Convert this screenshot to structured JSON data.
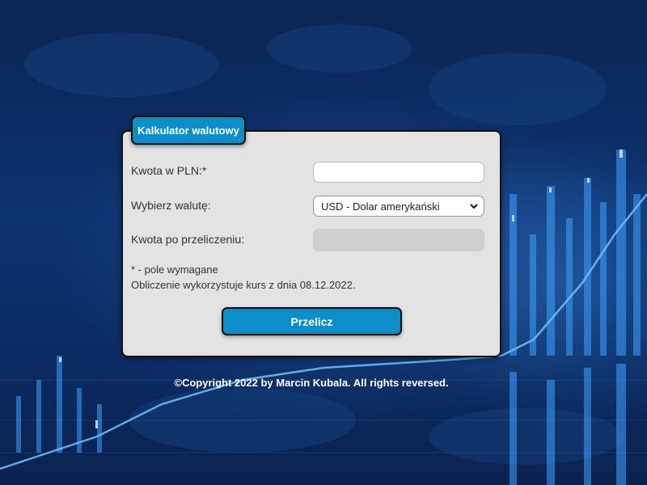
{
  "card": {
    "title": "Kalkulator walutowy",
    "amount_label": "Kwota w PLN:*",
    "amount_value": "",
    "currency_label": "Wybierz walutę:",
    "currency_selected": "USD - Dolar amerykański",
    "result_label": "Kwota po przeliczeniu:",
    "result_value": "",
    "required_note": "* - pole wymagane",
    "rate_note": "Obliczenie wykorzystuje kurs z dnia 08.12.2022.",
    "submit_label": "Przelicz"
  },
  "footer": {
    "copyright": "©Copyright 2022 by Marcin Kubala. All rights reversed."
  },
  "colors": {
    "accent": "#0b8ec9",
    "card_bg": "#e3e3e3",
    "page_bg": "#0b2a5a"
  },
  "icons": {
    "select_arrow": "chevron-down-icon"
  }
}
